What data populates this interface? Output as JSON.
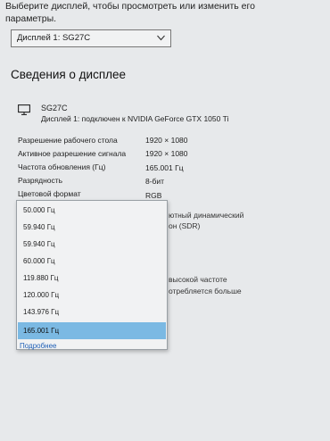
{
  "intro": {
    "line1": "Выберите дисплей, чтобы просмотреть или изменить его",
    "line2": "параметры."
  },
  "display_select": {
    "value": "Дисплей 1: SG27C",
    "icon": "chevron-down-icon"
  },
  "section_title": "Сведения о дисплее",
  "monitor": {
    "icon": "monitor-icon",
    "name": "SG27C",
    "connection": "Дисплей 1: подключен к NVIDIA GeForce GTX 1050 Ti"
  },
  "info_rows": [
    {
      "label": "Разрешение рабочего стола",
      "value": "1920 × 1080"
    },
    {
      "label": "Активное разрешение сигнала",
      "value": "1920 × 1080"
    },
    {
      "label": "Частота обновления (Гц)",
      "value": "165.001 Гц"
    },
    {
      "label": "Разрядность",
      "value": "8-бит"
    },
    {
      "label": "Цветовой формат",
      "value": "RGB"
    }
  ],
  "behind_text": {
    "line1": "ютный динамический",
    "line2": "он (SDR)",
    "line3": "высокой частоте",
    "line4": "отребляется больше"
  },
  "refresh_options": {
    "items": [
      "50.000 Гц",
      "59.940 Гц",
      "59.940 Гц",
      "60.000 Гц",
      "119.880 Гц",
      "120.000 Гц",
      "143.976 Гц",
      "165.001 Гц"
    ],
    "selected_index": 7
  },
  "more_link": "Подробнее"
}
